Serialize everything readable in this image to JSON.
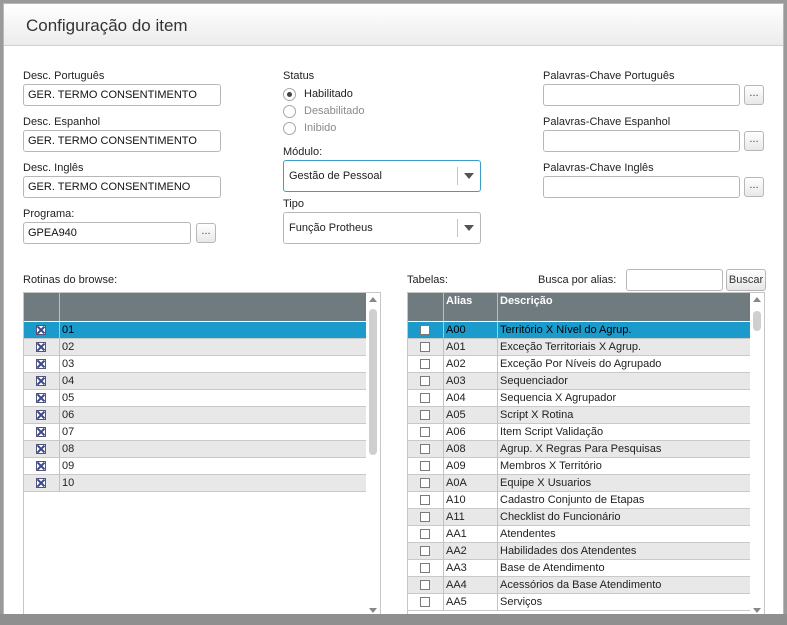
{
  "window": {
    "title": "Configuração do item"
  },
  "fields": {
    "desc_pt": {
      "label": "Desc. Português",
      "value": "GER. TERMO CONSENTIMENTO"
    },
    "desc_es": {
      "label": "Desc. Espanhol",
      "value": "GER. TERMO CONSENTIMENTO"
    },
    "desc_en": {
      "label": "Desc. Inglês",
      "value": "GER. TERMO CONSENTIMENO"
    },
    "programa": {
      "label": "Programa:",
      "value": "GPEA940",
      "button": "..."
    }
  },
  "status": {
    "label": "Status",
    "options": [
      {
        "label": "Habilitado",
        "selected": true
      },
      {
        "label": "Desabilitado",
        "selected": false
      },
      {
        "label": "Inibido",
        "selected": false
      }
    ]
  },
  "modulo": {
    "label": "Módulo:",
    "value": "Gestão de Pessoal"
  },
  "tipo": {
    "label": "Tipo",
    "value": "Função Protheus"
  },
  "keywords": {
    "pt": {
      "label": "Palavras-Chave Português",
      "value": "",
      "button": "..."
    },
    "es": {
      "label": "Palavras-Chave Espanhol",
      "value": "",
      "button": "..."
    },
    "en": {
      "label": "Palavras-Chave Inglês",
      "value": "",
      "button": "..."
    }
  },
  "rotinas": {
    "label": "Rotinas do browse:",
    "rows": [
      {
        "value": "01",
        "checked": true,
        "selected": true
      },
      {
        "value": "02",
        "checked": true
      },
      {
        "value": "03",
        "checked": true
      },
      {
        "value": "04",
        "checked": true
      },
      {
        "value": "05",
        "checked": true
      },
      {
        "value": "06",
        "checked": true
      },
      {
        "value": "07",
        "checked": true
      },
      {
        "value": "08",
        "checked": true
      },
      {
        "value": "09",
        "checked": true
      },
      {
        "value": "10",
        "checked": true
      }
    ]
  },
  "tabelas": {
    "label": "Tabelas:",
    "search_label": "Busca por alias:",
    "search_value": "",
    "search_button": "Buscar",
    "columns": {
      "alias": "Alias",
      "descricao": "Descrição"
    },
    "rows": [
      {
        "alias": "A00",
        "descricao": "Território X Nível do Agrup.",
        "selected": true
      },
      {
        "alias": "A01",
        "descricao": "Exceção Territoriais X Agrup."
      },
      {
        "alias": "A02",
        "descricao": "Exceção Por Níveis do Agrupado"
      },
      {
        "alias": "A03",
        "descricao": "Sequenciador"
      },
      {
        "alias": "A04",
        "descricao": "Sequencia X Agrupador"
      },
      {
        "alias": "A05",
        "descricao": "Script X Rotina"
      },
      {
        "alias": "A06",
        "descricao": "Item Script Validação"
      },
      {
        "alias": "A08",
        "descricao": "Agrup. X Regras Para Pesquisas"
      },
      {
        "alias": "A09",
        "descricao": "Membros X Território"
      },
      {
        "alias": "A0A",
        "descricao": "Equipe X Usuarios"
      },
      {
        "alias": "A10",
        "descricao": "Cadastro Conjunto de Etapas"
      },
      {
        "alias": "A11",
        "descricao": "Checklist do Funcionário"
      },
      {
        "alias": "AA1",
        "descricao": "Atendentes"
      },
      {
        "alias": "AA2",
        "descricao": "Habilidades dos Atendentes"
      },
      {
        "alias": "AA3",
        "descricao": "Base de Atendimento"
      },
      {
        "alias": "AA4",
        "descricao": "Acessórios da Base Atendimento"
      },
      {
        "alias": "AA5",
        "descricao": "Serviços"
      }
    ]
  }
}
